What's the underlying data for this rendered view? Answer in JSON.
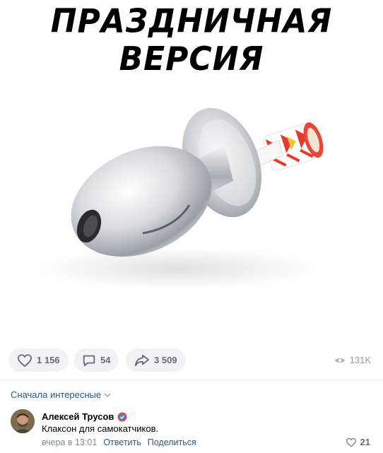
{
  "post": {
    "caption": "ПРАЗДНИЧНАЯ ВЕРСИЯ"
  },
  "actions": {
    "likes": "1 156",
    "comments": "54",
    "shares": "3 509",
    "views": "131K"
  },
  "comments_section": {
    "sort_label": "Сначала интересные"
  },
  "comment": {
    "author": "Алексей Трусов",
    "text": "Клаксон для самокатчиков.",
    "time": "вчера в 13:01",
    "reply_label": "Ответить",
    "share_label": "Поделиться",
    "likes": "21"
  },
  "colors": {
    "link": "#2a5885",
    "pill_bg": "#f0f2f5",
    "muted": "#818c99"
  }
}
